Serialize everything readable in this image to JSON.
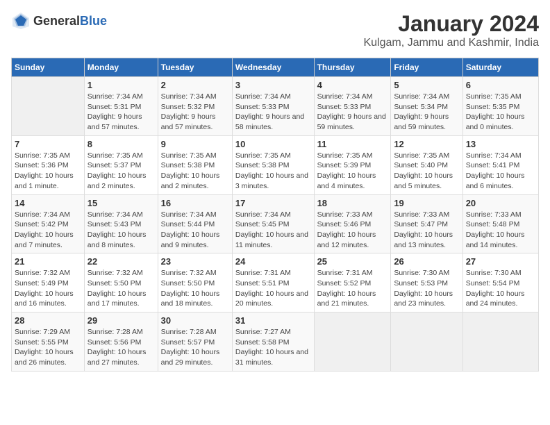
{
  "header": {
    "logo": {
      "general": "General",
      "blue": "Blue"
    },
    "title": "January 2024",
    "subtitle": "Kulgam, Jammu and Kashmir, India"
  },
  "calendar": {
    "columns": [
      "Sunday",
      "Monday",
      "Tuesday",
      "Wednesday",
      "Thursday",
      "Friday",
      "Saturday"
    ],
    "rows": [
      [
        {
          "day": "",
          "empty": true
        },
        {
          "day": "1",
          "sunrise": "Sunrise: 7:34 AM",
          "sunset": "Sunset: 5:31 PM",
          "daylight": "Daylight: 9 hours and 57 minutes."
        },
        {
          "day": "2",
          "sunrise": "Sunrise: 7:34 AM",
          "sunset": "Sunset: 5:32 PM",
          "daylight": "Daylight: 9 hours and 57 minutes."
        },
        {
          "day": "3",
          "sunrise": "Sunrise: 7:34 AM",
          "sunset": "Sunset: 5:33 PM",
          "daylight": "Daylight: 9 hours and 58 minutes."
        },
        {
          "day": "4",
          "sunrise": "Sunrise: 7:34 AM",
          "sunset": "Sunset: 5:33 PM",
          "daylight": "Daylight: 9 hours and 59 minutes."
        },
        {
          "day": "5",
          "sunrise": "Sunrise: 7:34 AM",
          "sunset": "Sunset: 5:34 PM",
          "daylight": "Daylight: 9 hours and 59 minutes."
        },
        {
          "day": "6",
          "sunrise": "Sunrise: 7:35 AM",
          "sunset": "Sunset: 5:35 PM",
          "daylight": "Daylight: 10 hours and 0 minutes."
        }
      ],
      [
        {
          "day": "7",
          "sunrise": "Sunrise: 7:35 AM",
          "sunset": "Sunset: 5:36 PM",
          "daylight": "Daylight: 10 hours and 1 minute."
        },
        {
          "day": "8",
          "sunrise": "Sunrise: 7:35 AM",
          "sunset": "Sunset: 5:37 PM",
          "daylight": "Daylight: 10 hours and 2 minutes."
        },
        {
          "day": "9",
          "sunrise": "Sunrise: 7:35 AM",
          "sunset": "Sunset: 5:38 PM",
          "daylight": "Daylight: 10 hours and 2 minutes."
        },
        {
          "day": "10",
          "sunrise": "Sunrise: 7:35 AM",
          "sunset": "Sunset: 5:38 PM",
          "daylight": "Daylight: 10 hours and 3 minutes."
        },
        {
          "day": "11",
          "sunrise": "Sunrise: 7:35 AM",
          "sunset": "Sunset: 5:39 PM",
          "daylight": "Daylight: 10 hours and 4 minutes."
        },
        {
          "day": "12",
          "sunrise": "Sunrise: 7:35 AM",
          "sunset": "Sunset: 5:40 PM",
          "daylight": "Daylight: 10 hours and 5 minutes."
        },
        {
          "day": "13",
          "sunrise": "Sunrise: 7:34 AM",
          "sunset": "Sunset: 5:41 PM",
          "daylight": "Daylight: 10 hours and 6 minutes."
        }
      ],
      [
        {
          "day": "14",
          "sunrise": "Sunrise: 7:34 AM",
          "sunset": "Sunset: 5:42 PM",
          "daylight": "Daylight: 10 hours and 7 minutes."
        },
        {
          "day": "15",
          "sunrise": "Sunrise: 7:34 AM",
          "sunset": "Sunset: 5:43 PM",
          "daylight": "Daylight: 10 hours and 8 minutes."
        },
        {
          "day": "16",
          "sunrise": "Sunrise: 7:34 AM",
          "sunset": "Sunset: 5:44 PM",
          "daylight": "Daylight: 10 hours and 9 minutes."
        },
        {
          "day": "17",
          "sunrise": "Sunrise: 7:34 AM",
          "sunset": "Sunset: 5:45 PM",
          "daylight": "Daylight: 10 hours and 11 minutes."
        },
        {
          "day": "18",
          "sunrise": "Sunrise: 7:33 AM",
          "sunset": "Sunset: 5:46 PM",
          "daylight": "Daylight: 10 hours and 12 minutes."
        },
        {
          "day": "19",
          "sunrise": "Sunrise: 7:33 AM",
          "sunset": "Sunset: 5:47 PM",
          "daylight": "Daylight: 10 hours and 13 minutes."
        },
        {
          "day": "20",
          "sunrise": "Sunrise: 7:33 AM",
          "sunset": "Sunset: 5:48 PM",
          "daylight": "Daylight: 10 hours and 14 minutes."
        }
      ],
      [
        {
          "day": "21",
          "sunrise": "Sunrise: 7:32 AM",
          "sunset": "Sunset: 5:49 PM",
          "daylight": "Daylight: 10 hours and 16 minutes."
        },
        {
          "day": "22",
          "sunrise": "Sunrise: 7:32 AM",
          "sunset": "Sunset: 5:50 PM",
          "daylight": "Daylight: 10 hours and 17 minutes."
        },
        {
          "day": "23",
          "sunrise": "Sunrise: 7:32 AM",
          "sunset": "Sunset: 5:50 PM",
          "daylight": "Daylight: 10 hours and 18 minutes."
        },
        {
          "day": "24",
          "sunrise": "Sunrise: 7:31 AM",
          "sunset": "Sunset: 5:51 PM",
          "daylight": "Daylight: 10 hours and 20 minutes."
        },
        {
          "day": "25",
          "sunrise": "Sunrise: 7:31 AM",
          "sunset": "Sunset: 5:52 PM",
          "daylight": "Daylight: 10 hours and 21 minutes."
        },
        {
          "day": "26",
          "sunrise": "Sunrise: 7:30 AM",
          "sunset": "Sunset: 5:53 PM",
          "daylight": "Daylight: 10 hours and 23 minutes."
        },
        {
          "day": "27",
          "sunrise": "Sunrise: 7:30 AM",
          "sunset": "Sunset: 5:54 PM",
          "daylight": "Daylight: 10 hours and 24 minutes."
        }
      ],
      [
        {
          "day": "28",
          "sunrise": "Sunrise: 7:29 AM",
          "sunset": "Sunset: 5:55 PM",
          "daylight": "Daylight: 10 hours and 26 minutes."
        },
        {
          "day": "29",
          "sunrise": "Sunrise: 7:28 AM",
          "sunset": "Sunset: 5:56 PM",
          "daylight": "Daylight: 10 hours and 27 minutes."
        },
        {
          "day": "30",
          "sunrise": "Sunrise: 7:28 AM",
          "sunset": "Sunset: 5:57 PM",
          "daylight": "Daylight: 10 hours and 29 minutes."
        },
        {
          "day": "31",
          "sunrise": "Sunrise: 7:27 AM",
          "sunset": "Sunset: 5:58 PM",
          "daylight": "Daylight: 10 hours and 31 minutes."
        },
        {
          "day": "",
          "empty": true
        },
        {
          "day": "",
          "empty": true
        },
        {
          "day": "",
          "empty": true
        }
      ]
    ]
  }
}
